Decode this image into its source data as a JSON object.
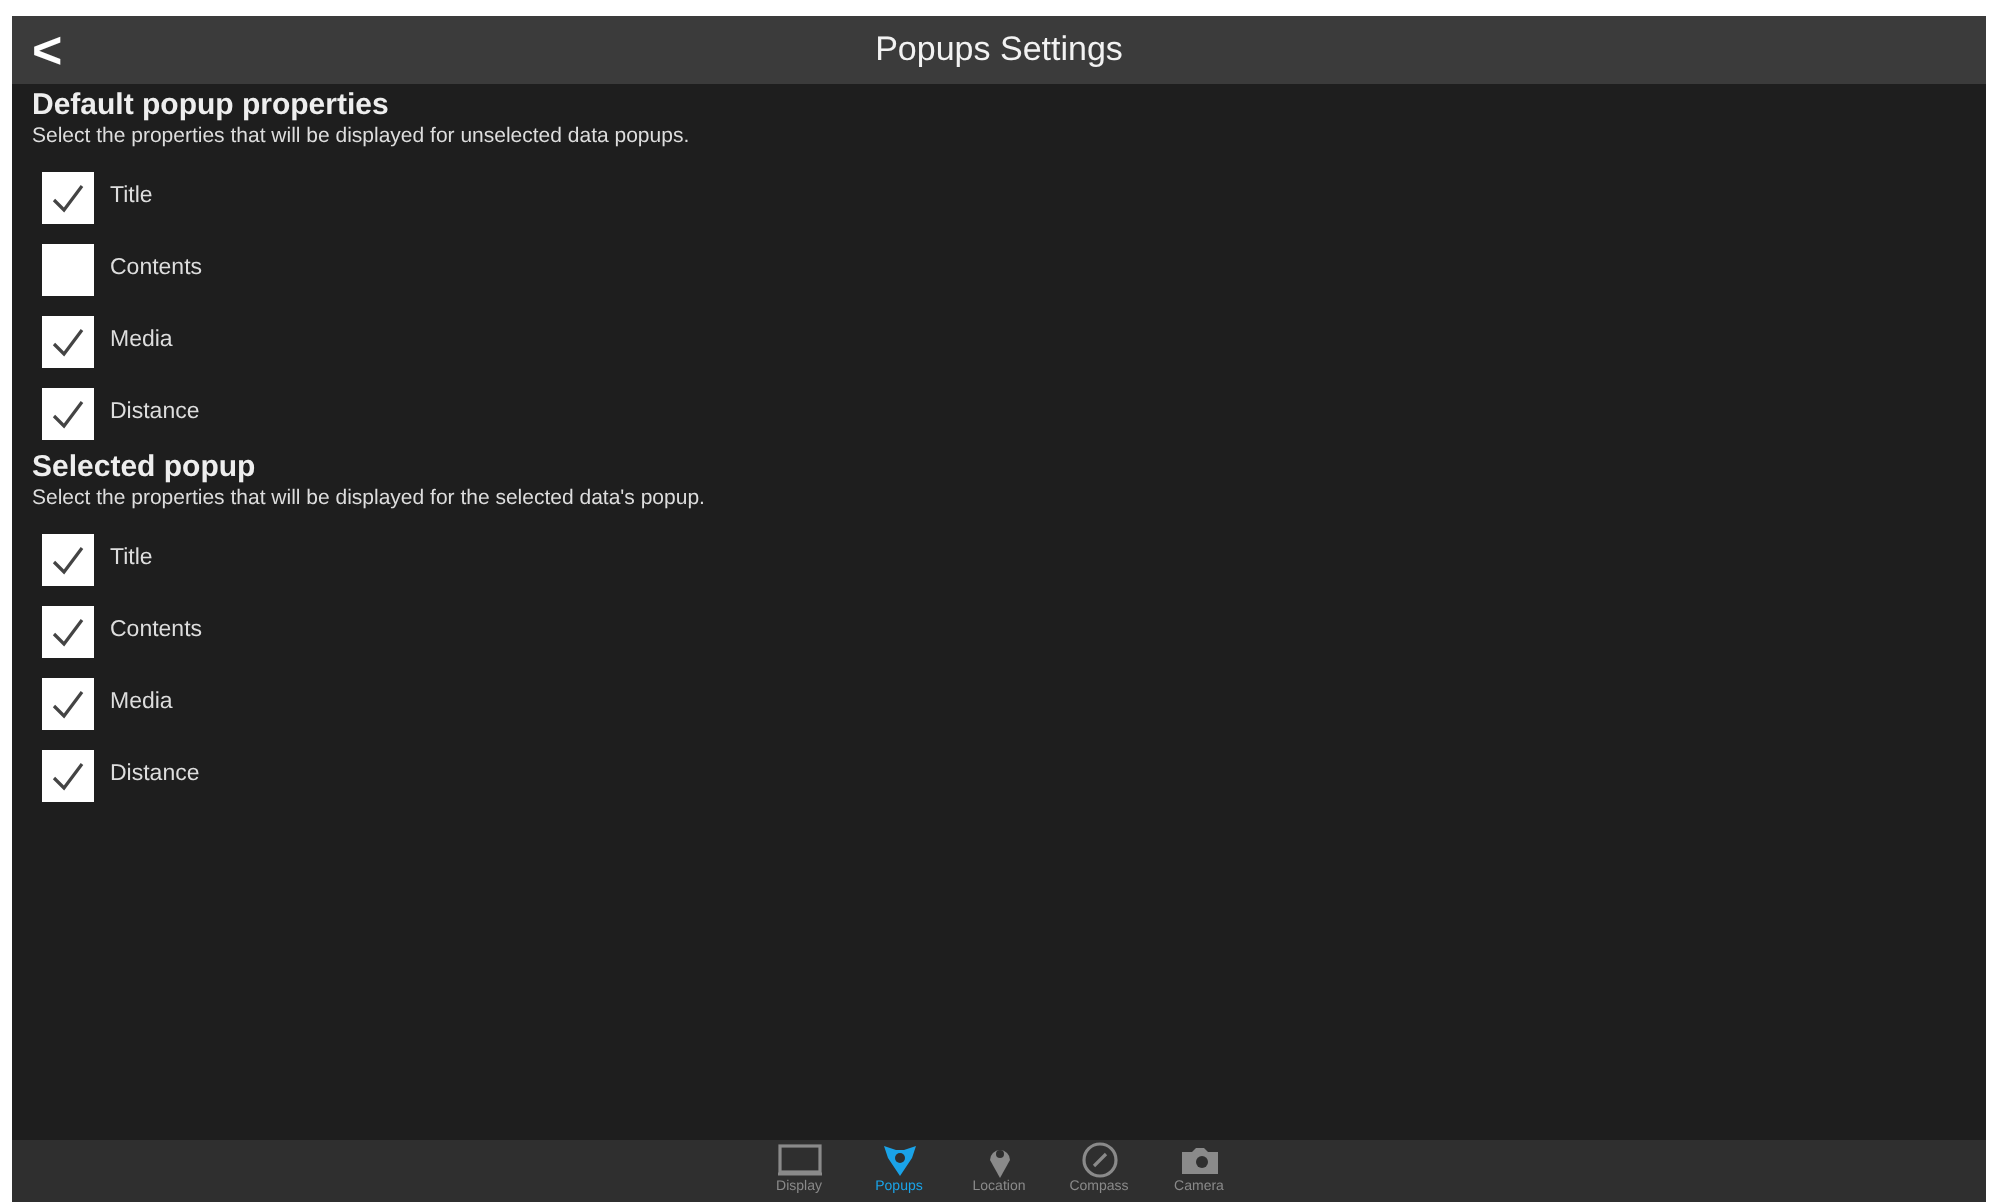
{
  "header": {
    "back": "<",
    "title": "Popups Settings"
  },
  "sections": [
    {
      "title": "Default popup properties",
      "description": "Select the properties that will be displayed for unselected data popups.",
      "options": [
        {
          "label": "Title",
          "checked": true
        },
        {
          "label": "Contents",
          "checked": false
        },
        {
          "label": "Media",
          "checked": true
        },
        {
          "label": "Distance",
          "checked": true
        }
      ]
    },
    {
      "title": "Selected popup",
      "description": "Select the properties that will be displayed for the selected data's popup.",
      "options": [
        {
          "label": "Title",
          "checked": true
        },
        {
          "label": "Contents",
          "checked": true
        },
        {
          "label": "Media",
          "checked": true
        },
        {
          "label": "Distance",
          "checked": true
        }
      ]
    }
  ],
  "tabs": [
    {
      "label": "Display",
      "kind": "display",
      "selected": false
    },
    {
      "label": "Popups",
      "kind": "popups",
      "selected": true
    },
    {
      "label": "Location",
      "kind": "location",
      "selected": false
    },
    {
      "label": "Compass",
      "kind": "compass",
      "selected": false
    },
    {
      "label": "Camera",
      "kind": "camera",
      "selected": false
    }
  ]
}
